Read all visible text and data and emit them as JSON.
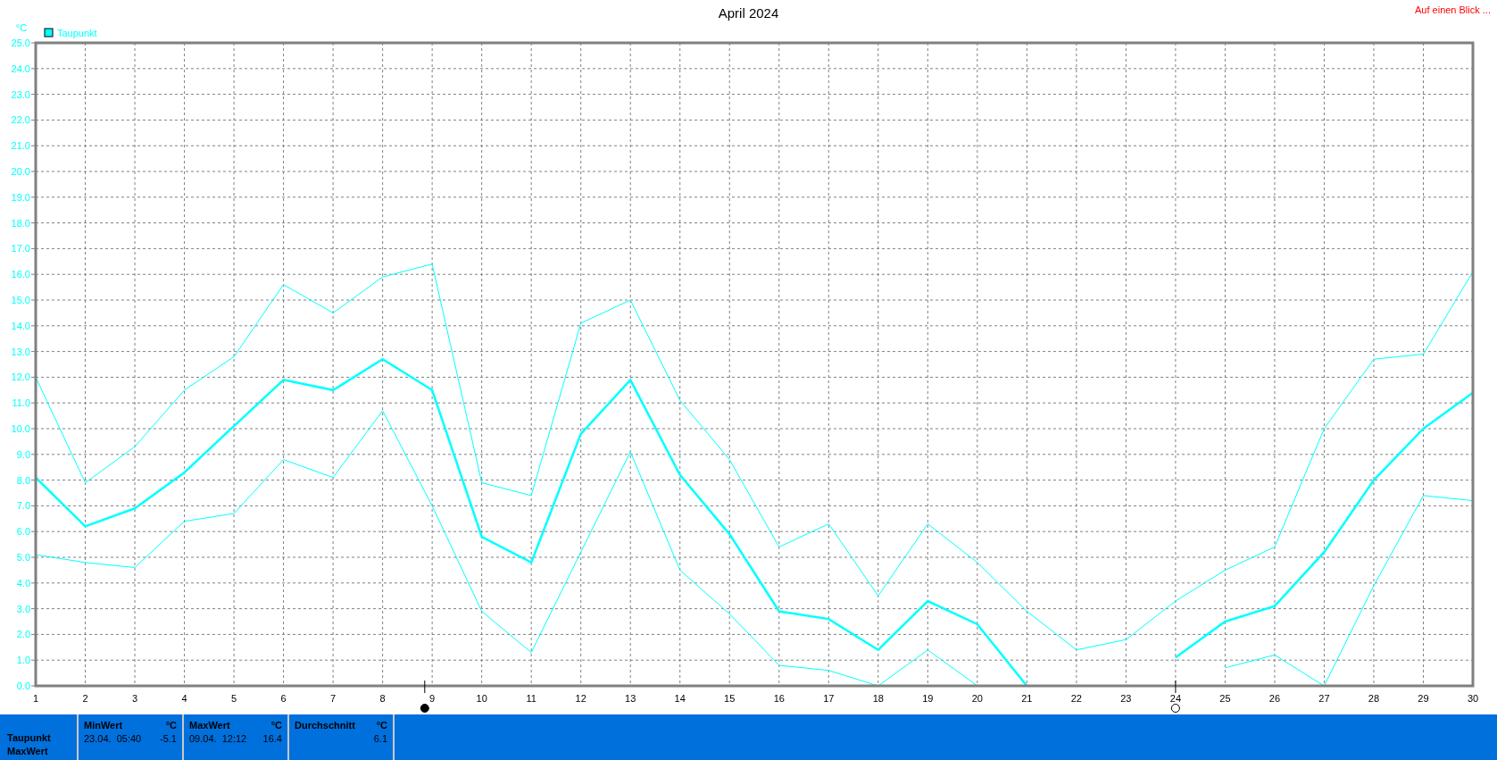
{
  "chart": {
    "header_link": "Auf einen Blick ...",
    "chart_data": {
      "type": "line",
      "title": "April 2024",
      "ylabel": "°C",
      "grid": true,
      "x": [
        1,
        2,
        3,
        4,
        5,
        6,
        7,
        8,
        9,
        10,
        11,
        12,
        13,
        14,
        15,
        16,
        17,
        18,
        19,
        20,
        21,
        22,
        23,
        24,
        25,
        26,
        27,
        28,
        29,
        30
      ],
      "series": [
        {
          "color": "#00ffff",
          "values": [
            12.0,
            7.9,
            9.3,
            11.5,
            12.8,
            15.6,
            14.5,
            15.9,
            16.4,
            7.9,
            7.4,
            14.1,
            15.0,
            11.1,
            8.8,
            5.4,
            6.3,
            3.5,
            6.3,
            4.8,
            2.9,
            1.4,
            1.8,
            3.3,
            4.5,
            5.4,
            10.0,
            12.7,
            12.9,
            16.1
          ]
        },
        {
          "name": "Taupunkt",
          "color": "#00ffff",
          "values": [
            8.1,
            6.2,
            6.9,
            8.3,
            10.1,
            11.9,
            11.5,
            12.7,
            11.5,
            5.8,
            4.8,
            9.8,
            11.9,
            8.2,
            5.9,
            2.9,
            2.6,
            1.4,
            3.3,
            2.4,
            0.0,
            null,
            null,
            1.1,
            2.5,
            3.1,
            5.2,
            8.0,
            10.0,
            11.4
          ]
        },
        {
          "color": "#00ffff",
          "values": [
            5.1,
            4.8,
            4.6,
            6.4,
            6.7,
            8.8,
            8.1,
            10.7,
            7.0,
            2.9,
            1.3,
            5.2,
            9.1,
            4.5,
            2.8,
            0.8,
            0.6,
            0.0,
            1.4,
            0.0,
            null,
            null,
            null,
            null,
            0.7,
            1.2,
            0.0,
            3.9,
            7.4,
            7.2
          ]
        }
      ],
      "xlim": [
        1,
        30
      ],
      "ylim": [
        0,
        25
      ],
      "xticks": [
        1,
        2,
        3,
        4,
        5,
        6,
        7,
        8,
        9,
        10,
        11,
        12,
        13,
        14,
        15,
        16,
        17,
        18,
        19,
        20,
        21,
        22,
        23,
        24,
        25,
        26,
        27,
        28,
        29,
        30
      ],
      "yticks": [
        {
          "value": 0,
          "label": "0.0"
        },
        {
          "value": 1,
          "label": "1.0"
        },
        {
          "value": 2,
          "label": "2.0"
        },
        {
          "value": 3,
          "label": "3.0"
        },
        {
          "value": 4,
          "label": "4.0"
        },
        {
          "value": 5,
          "label": "5.0"
        },
        {
          "value": 6,
          "label": "6.0"
        },
        {
          "value": 7,
          "label": "7.0"
        },
        {
          "value": 8,
          "label": "8.0"
        },
        {
          "value": 9,
          "label": "9.0"
        },
        {
          "value": 10,
          "label": "10.0"
        },
        {
          "value": 11,
          "label": "11.0"
        },
        {
          "value": 12,
          "label": "12.0"
        },
        {
          "value": 13,
          "label": "13.0"
        },
        {
          "value": 14,
          "label": "14.0"
        },
        {
          "value": 15,
          "label": "15.0"
        },
        {
          "value": 16,
          "label": "16.0"
        },
        {
          "value": 17,
          "label": "17.0"
        },
        {
          "value": 18,
          "label": "18.0"
        },
        {
          "value": 19,
          "label": "19.0"
        },
        {
          "value": 20,
          "label": "20.0"
        },
        {
          "value": 21,
          "label": "21.0"
        },
        {
          "value": 22,
          "label": "22.0"
        },
        {
          "value": 23,
          "label": "23.0"
        },
        {
          "value": 24,
          "label": "24.0"
        },
        {
          "value": 25,
          "label": "25.0"
        }
      ]
    }
  },
  "stats": {
    "row_labels": [
      "Taupunkt",
      "MaxWert"
    ],
    "columns": [
      {
        "heading": "MinWert",
        "unit": "°C",
        "time": "23.04.  05:40",
        "value": "-5.1"
      },
      {
        "heading": "MaxWert",
        "unit": "°C",
        "time": "09.04.  12:12",
        "value": "16.4"
      },
      {
        "heading": "Durchschnitt",
        "unit": "°C",
        "value": "6.1"
      }
    ]
  }
}
